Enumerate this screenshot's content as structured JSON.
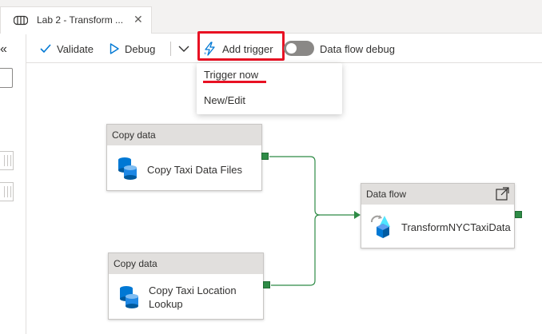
{
  "tab": {
    "title": "Lab 2 - Transform ...",
    "close_glyph": "✕",
    "icon": "pipeline-icon"
  },
  "rail": {
    "collapse_glyph": "«"
  },
  "toolbar": {
    "validate_label": "Validate",
    "debug_label": "Debug",
    "add_trigger_label": "Add trigger",
    "data_flow_debug_label": "Data flow debug",
    "data_flow_debug_on": false
  },
  "trigger_menu": {
    "items": [
      {
        "label": "Trigger now"
      },
      {
        "label": "New/Edit"
      }
    ]
  },
  "nodes": {
    "copy1": {
      "type_label": "Copy data",
      "name": "Copy Taxi Data Files"
    },
    "copy2": {
      "type_label": "Copy data",
      "name": "Copy Taxi Location Lookup"
    },
    "dataflow": {
      "type_label": "Data flow",
      "name": "TransformNYCTaxiData"
    }
  },
  "colors": {
    "highlight": "#e81123",
    "accent": "#0078d4",
    "success_port": "#2e8b46",
    "toggle_off": "#8a8886"
  }
}
